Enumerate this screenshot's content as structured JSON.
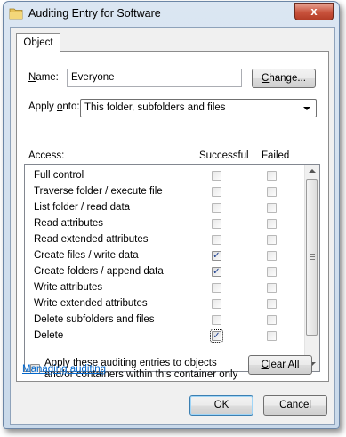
{
  "window": {
    "title": "Auditing Entry for Software",
    "close_glyph": "x"
  },
  "tabs": [
    {
      "label": "Object"
    }
  ],
  "name_field": {
    "label": "Name:",
    "value": "Everyone",
    "button": "Change..."
  },
  "apply_onto": {
    "label": "Apply onto:",
    "value": "This folder, subfolders and files"
  },
  "access": {
    "label": "Access:",
    "col_successful": "Successful",
    "col_failed": "Failed",
    "rows": [
      {
        "name": "Full control",
        "successful": false,
        "failed": false
      },
      {
        "name": "Traverse folder / execute file",
        "successful": false,
        "failed": false
      },
      {
        "name": "List folder / read data",
        "successful": false,
        "failed": false
      },
      {
        "name": "Read attributes",
        "successful": false,
        "failed": false
      },
      {
        "name": "Read extended attributes",
        "successful": false,
        "failed": false
      },
      {
        "name": "Create files / write data",
        "successful": true,
        "failed": false
      },
      {
        "name": "Create folders / append data",
        "successful": true,
        "failed": false
      },
      {
        "name": "Write attributes",
        "successful": false,
        "failed": false
      },
      {
        "name": "Write extended attributes",
        "successful": false,
        "failed": false
      },
      {
        "name": "Delete subfolders and files",
        "successful": false,
        "failed": false
      },
      {
        "name": "Delete",
        "successful": true,
        "failed": false
      }
    ]
  },
  "apply_checkbox": {
    "line1": "Apply these auditing entries to objects",
    "line2": "and/or containers within this container only",
    "checked": false
  },
  "clear_all": "Clear All",
  "managing_link": "Managing auditing",
  "ok": "OK",
  "cancel": "Cancel",
  "colors": {
    "link": "#0066cc",
    "close": "#c8523c",
    "title_bg": "#dbe6f2"
  }
}
